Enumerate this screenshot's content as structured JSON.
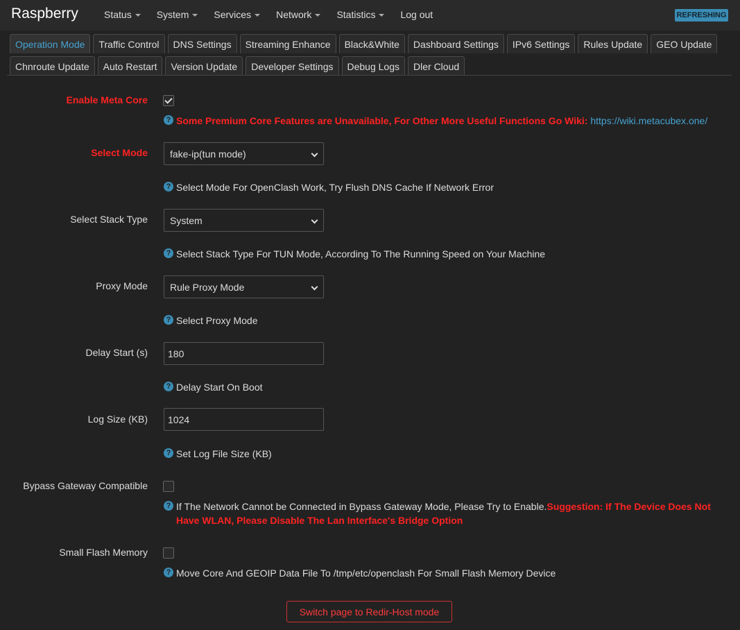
{
  "brand": "Raspberry",
  "menu": [
    "Status",
    "System",
    "Services",
    "Network",
    "Statistics",
    "Log out"
  ],
  "badge": "REFRESHING",
  "tabs_row1": [
    "Operation Mode",
    "Traffic Control",
    "DNS Settings",
    "Streaming Enhance",
    "Black&White",
    "Dashboard Settings",
    "IPv6 Settings",
    "Rules Update",
    "GEO Update"
  ],
  "tabs_row2": [
    "Chnroute Update",
    "Auto Restart",
    "Version Update",
    "Developer Settings",
    "Debug Logs",
    "Dler Cloud"
  ],
  "form": {
    "meta_core": {
      "label": "Enable Meta Core",
      "checked": true,
      "help_red": "Some Premium Core Features are Unavailable, For Other More Useful Functions Go Wiki: ",
      "help_link": "https://wiki.metacubex.one/"
    },
    "select_mode": {
      "label": "Select Mode",
      "value": "fake-ip(tun mode)",
      "help": "Select Mode For OpenClash Work, Try Flush DNS Cache If Network Error"
    },
    "stack_type": {
      "label": "Select Stack Type",
      "value": "System",
      "help": "Select Stack Type For TUN Mode, According To The Running Speed on Your Machine"
    },
    "proxy_mode": {
      "label": "Proxy Mode",
      "value": "Rule Proxy Mode",
      "help": "Select Proxy Mode"
    },
    "delay_start": {
      "label": "Delay Start (s)",
      "value": "180",
      "help": "Delay Start On Boot"
    },
    "log_size": {
      "label": "Log Size (KB)",
      "value": "1024",
      "help": "Set Log File Size (KB)"
    },
    "bypass_gateway": {
      "label": "Bypass Gateway Compatible",
      "checked": false,
      "help": "If The Network Cannot be Connected in Bypass Gateway Mode, Please Try to Enable.",
      "help_red_1": "Suggestion: If The Device Does Not",
      "help_red_2": "Have WLAN, Please Disable The Lan Interface's Bridge Option"
    },
    "small_flash": {
      "label": "Small Flash Memory",
      "checked": false,
      "help": "Move Core And GEOIP Data File To /tmp/etc/openclash For Small Flash Memory Device"
    }
  },
  "help_icon_glyph": "?",
  "switch_button": "Switch page to Redir-Host mode",
  "colors": {
    "background": "#222222",
    "accent": "#46a3d1",
    "warning": "#ff2222"
  }
}
